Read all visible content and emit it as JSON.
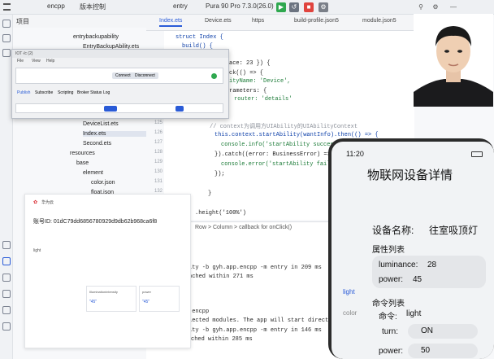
{
  "titlebar": {
    "project": "encpp",
    "vcs": "版本控制",
    "entry": "entry",
    "device": "Pura 90 Pro 7.3.0(26.0)"
  },
  "left_panel": {
    "header": "项目",
    "tree": [
      "entrybackupability",
      "EntryBackupAbility.ets",
      "DeviceList.ets",
      "Index.ets",
      "Second.ets",
      "resources",
      "base",
      "element",
      "color.json",
      "float.json"
    ]
  },
  "editor": {
    "tabs": [
      "Index.ets",
      "Device.ets",
      "https",
      "build-profile.json5",
      "module.json5"
    ],
    "line_numbers": [
      "124",
      "125",
      "126",
      "127",
      "128",
      "129",
      "130",
      "131",
      "132",
      "133"
    ],
    "code": [
      "struct Index {",
      "build() {",
      "ace: 23 }) {",
      "ck(() => {",
      "ityName: 'Device',",
      "rameters: {",
      "router: 'details'",
      "// context为调用方UIAbility的UIAbilityContext",
      "this.context.startAbility(wantInfo).then(() => {",
      "console.info('startAbility succes",
      "}).catch((error: BusinessError) =>",
      "console.error('startAbility failed",
      "});",
      "}",
      ".height('100%')"
    ],
    "breadcrumb": "Row  >  Column  >  callback for onClick()"
  },
  "console": {
    "lines": [
      "ity -b gyh.app.encpp -m entry in 209 ms",
      "nched within 271 ms",
      ".encpp",
      "lected modules. The app will start directly.",
      "ity -b gyh.app.encpp -m entry in 146 ms",
      "16:37:23.775: gyh.app.encpp successfully launched within 285 ms"
    ]
  },
  "dialog": {
    "title": "IOT·/c (2)",
    "menu": [
      "File",
      "View",
      "Help"
    ],
    "tabs": [
      "Publish",
      "Subscribe",
      "Scripting",
      "Broker Status",
      "Log"
    ],
    "action": "Connect",
    "disconnect": "Disconnect"
  },
  "device_card": {
    "brand": "华为云",
    "id_label": "账号ID: 01dC79dd6856780929d9db62b968ca6f8",
    "name_value": "light",
    "attr_label": "Illuminationintensity",
    "attr_value": "\"45\"",
    "attr2_label": "power",
    "attr2_value": "\"45\""
  },
  "phone": {
    "time": "11:20",
    "title": "物联网设备详情",
    "device_name_label": "设备名称:",
    "device_name_value": "往室吸顶灯",
    "attr_list_label": "属性列表",
    "luminance_label": "luminance:",
    "luminance_value": "28",
    "power_label": "power:",
    "power_value": "45",
    "cmd_list_label": "命令列表",
    "cmd_label": "命令:",
    "cmd_value": "light",
    "turn_label": "turn:",
    "turn_value": "ON",
    "power2_label": "power:",
    "power2_value": "50",
    "side_light": "light",
    "side_color": "color"
  },
  "colors": {
    "accent": "#2a5bd7",
    "run_green": "#2fa84f",
    "stop_red": "#e0443e"
  }
}
